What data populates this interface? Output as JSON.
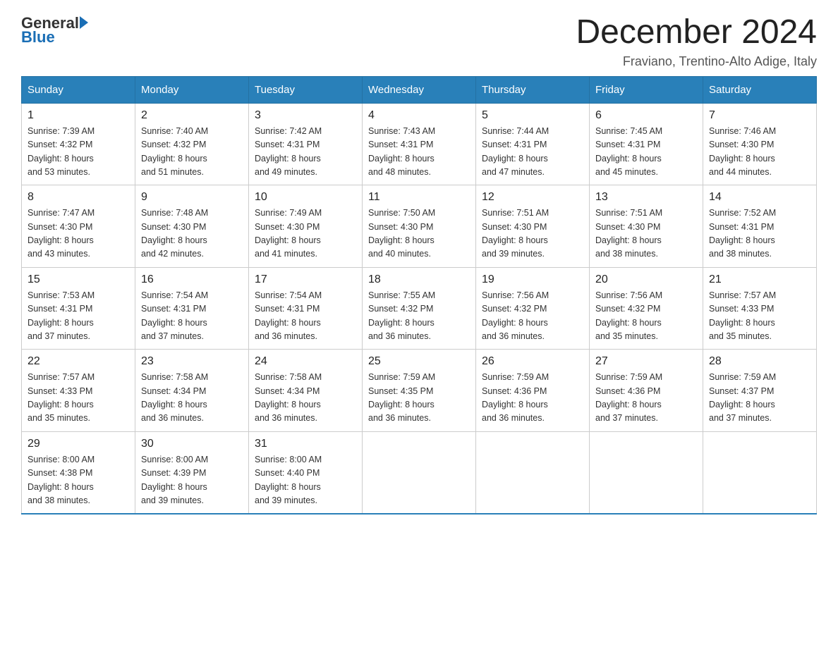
{
  "header": {
    "logo_general": "General",
    "logo_blue": "Blue",
    "month_title": "December 2024",
    "location": "Fraviano, Trentino-Alto Adige, Italy"
  },
  "days_of_week": [
    "Sunday",
    "Monday",
    "Tuesday",
    "Wednesday",
    "Thursday",
    "Friday",
    "Saturday"
  ],
  "weeks": [
    [
      {
        "day": "1",
        "sunrise": "7:39 AM",
        "sunset": "4:32 PM",
        "daylight": "8 hours and 53 minutes."
      },
      {
        "day": "2",
        "sunrise": "7:40 AM",
        "sunset": "4:32 PM",
        "daylight": "8 hours and 51 minutes."
      },
      {
        "day": "3",
        "sunrise": "7:42 AM",
        "sunset": "4:31 PM",
        "daylight": "8 hours and 49 minutes."
      },
      {
        "day": "4",
        "sunrise": "7:43 AM",
        "sunset": "4:31 PM",
        "daylight": "8 hours and 48 minutes."
      },
      {
        "day": "5",
        "sunrise": "7:44 AM",
        "sunset": "4:31 PM",
        "daylight": "8 hours and 47 minutes."
      },
      {
        "day": "6",
        "sunrise": "7:45 AM",
        "sunset": "4:31 PM",
        "daylight": "8 hours and 45 minutes."
      },
      {
        "day": "7",
        "sunrise": "7:46 AM",
        "sunset": "4:30 PM",
        "daylight": "8 hours and 44 minutes."
      }
    ],
    [
      {
        "day": "8",
        "sunrise": "7:47 AM",
        "sunset": "4:30 PM",
        "daylight": "8 hours and 43 minutes."
      },
      {
        "day": "9",
        "sunrise": "7:48 AM",
        "sunset": "4:30 PM",
        "daylight": "8 hours and 42 minutes."
      },
      {
        "day": "10",
        "sunrise": "7:49 AM",
        "sunset": "4:30 PM",
        "daylight": "8 hours and 41 minutes."
      },
      {
        "day": "11",
        "sunrise": "7:50 AM",
        "sunset": "4:30 PM",
        "daylight": "8 hours and 40 minutes."
      },
      {
        "day": "12",
        "sunrise": "7:51 AM",
        "sunset": "4:30 PM",
        "daylight": "8 hours and 39 minutes."
      },
      {
        "day": "13",
        "sunrise": "7:51 AM",
        "sunset": "4:30 PM",
        "daylight": "8 hours and 38 minutes."
      },
      {
        "day": "14",
        "sunrise": "7:52 AM",
        "sunset": "4:31 PM",
        "daylight": "8 hours and 38 minutes."
      }
    ],
    [
      {
        "day": "15",
        "sunrise": "7:53 AM",
        "sunset": "4:31 PM",
        "daylight": "8 hours and 37 minutes."
      },
      {
        "day": "16",
        "sunrise": "7:54 AM",
        "sunset": "4:31 PM",
        "daylight": "8 hours and 37 minutes."
      },
      {
        "day": "17",
        "sunrise": "7:54 AM",
        "sunset": "4:31 PM",
        "daylight": "8 hours and 36 minutes."
      },
      {
        "day": "18",
        "sunrise": "7:55 AM",
        "sunset": "4:32 PM",
        "daylight": "8 hours and 36 minutes."
      },
      {
        "day": "19",
        "sunrise": "7:56 AM",
        "sunset": "4:32 PM",
        "daylight": "8 hours and 36 minutes."
      },
      {
        "day": "20",
        "sunrise": "7:56 AM",
        "sunset": "4:32 PM",
        "daylight": "8 hours and 35 minutes."
      },
      {
        "day": "21",
        "sunrise": "7:57 AM",
        "sunset": "4:33 PM",
        "daylight": "8 hours and 35 minutes."
      }
    ],
    [
      {
        "day": "22",
        "sunrise": "7:57 AM",
        "sunset": "4:33 PM",
        "daylight": "8 hours and 35 minutes."
      },
      {
        "day": "23",
        "sunrise": "7:58 AM",
        "sunset": "4:34 PM",
        "daylight": "8 hours and 36 minutes."
      },
      {
        "day": "24",
        "sunrise": "7:58 AM",
        "sunset": "4:34 PM",
        "daylight": "8 hours and 36 minutes."
      },
      {
        "day": "25",
        "sunrise": "7:59 AM",
        "sunset": "4:35 PM",
        "daylight": "8 hours and 36 minutes."
      },
      {
        "day": "26",
        "sunrise": "7:59 AM",
        "sunset": "4:36 PM",
        "daylight": "8 hours and 36 minutes."
      },
      {
        "day": "27",
        "sunrise": "7:59 AM",
        "sunset": "4:36 PM",
        "daylight": "8 hours and 37 minutes."
      },
      {
        "day": "28",
        "sunrise": "7:59 AM",
        "sunset": "4:37 PM",
        "daylight": "8 hours and 37 minutes."
      }
    ],
    [
      {
        "day": "29",
        "sunrise": "8:00 AM",
        "sunset": "4:38 PM",
        "daylight": "8 hours and 38 minutes."
      },
      {
        "day": "30",
        "sunrise": "8:00 AM",
        "sunset": "4:39 PM",
        "daylight": "8 hours and 39 minutes."
      },
      {
        "day": "31",
        "sunrise": "8:00 AM",
        "sunset": "4:40 PM",
        "daylight": "8 hours and 39 minutes."
      },
      null,
      null,
      null,
      null
    ]
  ],
  "labels": {
    "sunrise": "Sunrise:",
    "sunset": "Sunset:",
    "daylight": "Daylight:"
  }
}
